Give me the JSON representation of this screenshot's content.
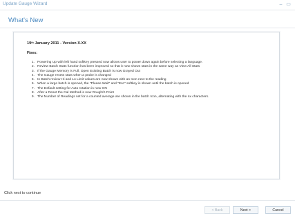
{
  "window": {
    "title": "Update Gauge Wizard",
    "minimize_glyph": "–",
    "maximize_glyph": "▭"
  },
  "page": {
    "heading": "What's New"
  },
  "release": {
    "date_day": "19",
    "date_suffix": "th",
    "date_rest": " January 2011 - Version X.XX",
    "fixes_label": "Fixes:",
    "fixes": [
      {
        "num": "1.",
        "text": "Powering Up with left hand softkey pressed now allows user to power down again before selecting a language."
      },
      {
        "num": "2.",
        "text": "Review Batch Stats function has been improved so that it now shows stats in the same way as View All Stats"
      },
      {
        "num": "3.",
        "text": "If the Gauge Memory is Full, Open Existing Batch is now Grayed Out"
      },
      {
        "num": "4.",
        "text": "The Gauge resets stats when a probe is changed"
      },
      {
        "num": "5.",
        "text": "In Batch review Hi and Lo Limit values are now shown with an Icon next to the reading"
      },
      {
        "num": "6.",
        "text": "When a large batch is opened, the \"Please Wait\" and \"Esc\" softkey is shown until the batch is opened"
      },
      {
        "num": "7.",
        "text": "The Default setting for Auto rotation is now ON"
      },
      {
        "num": "8.",
        "text": "After a Reset the Cal Method is now Rough/2-Point"
      },
      {
        "num": "9.",
        "text": "The Number of Readings set for a counted average are shown in the batch Icon, alternating with the nx characters."
      }
    ]
  },
  "footer": {
    "instruction": "Click next to continue",
    "back_label": "< Back",
    "next_label": "Next >",
    "cancel_label": "Cancel"
  },
  "colors": {
    "accent": "#4a89c0",
    "title_text": "#7aa3c7"
  }
}
